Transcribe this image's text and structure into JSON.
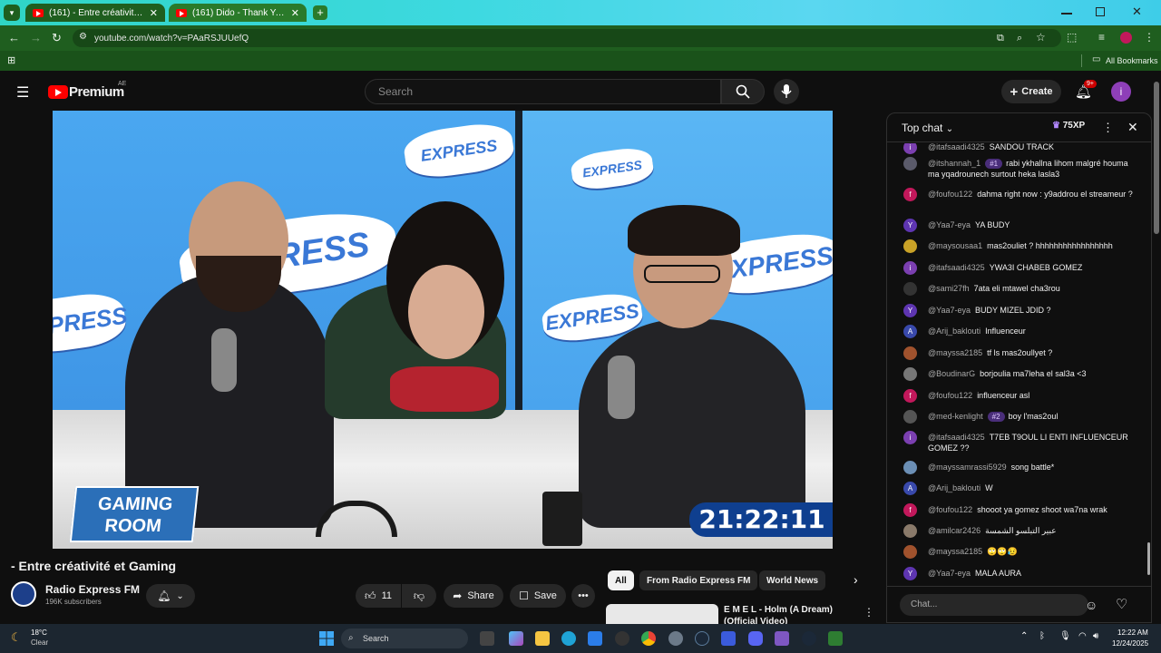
{
  "browser": {
    "tabs": [
      {
        "label": "(161) - Entre créativité et G",
        "active": true
      },
      {
        "label": "(161) Dido - Thank You (Officia",
        "active": false
      }
    ],
    "url": "youtube.com/watch?v=PAaRSJUUefQ",
    "bookmarks_label": "All Bookmarks"
  },
  "youtube": {
    "logo_text": "Premium",
    "region": "AE",
    "search_placeholder": "Search",
    "create_label": "Create",
    "notif_count": "9+",
    "avatar_letter": "i"
  },
  "video": {
    "brand_text": "EXPRESS",
    "timer": "21:22:11",
    "gaming_room_line1": "GAMING",
    "gaming_room_line2": "ROOM",
    "title": "- Entre créativité et Gaming",
    "channel_name": "Radio Express FM",
    "subscribers": "196K subscribers",
    "like_count": "11",
    "share_label": "Share",
    "save_label": "Save"
  },
  "recommendations": {
    "chips": [
      "All",
      "From Radio Express FM",
      "World News"
    ],
    "first_title_line1": "E M E L - Holm (A Dream)",
    "first_title_line2": "(Official Video)"
  },
  "chat": {
    "title": "Top chat",
    "xp": "75XP",
    "input_placeholder": "Chat...",
    "messages": [
      {
        "author": "@itafsaadi4325",
        "text": "SANDOU TRACK",
        "badge": "",
        "avatar": "i",
        "color": "#7b3fb0"
      },
      {
        "author": "@itshannah_1",
        "text": "rabi ykhallna lihom malgré houma ma yqadrounech surtout heka lasla3",
        "badge": "#1",
        "avatar": "",
        "color": "#5a5a6a"
      },
      {
        "author": "@foufou122",
        "text": "dahma right now : y9addrou el streameur ?",
        "badge": "",
        "avatar": "f",
        "color": "#c2185b"
      },
      {
        "author": "@Yaa7-eya",
        "text": "YA BUDY",
        "badge": "",
        "avatar": "Y",
        "color": "#5e35b1"
      },
      {
        "author": "@maysousaa1",
        "text": "mas2ouliet ? hhhhhhhhhhhhhhhhh",
        "badge": "",
        "avatar": "",
        "color": "#c9a227"
      },
      {
        "author": "@itafsaadi4325",
        "text": "YWA3I CHABEB GOMEZ",
        "badge": "",
        "avatar": "i",
        "color": "#7b3fb0"
      },
      {
        "author": "@sami27fh",
        "text": "7ata eli mtawel cha3rou",
        "badge": "",
        "avatar": "",
        "color": "#333333"
      },
      {
        "author": "@Yaa7-eya",
        "text": "BUDY MIZEL JDID ?",
        "badge": "",
        "avatar": "Y",
        "color": "#5e35b1"
      },
      {
        "author": "@Arij_baklouti",
        "text": "Influenceur",
        "badge": "",
        "avatar": "A",
        "color": "#3949ab"
      },
      {
        "author": "@mayssa2185",
        "text": "tf ls mas2oullyet ?",
        "badge": "",
        "avatar": "",
        "color": "#a0522d"
      },
      {
        "author": "@BoudinarG",
        "text": "borjoulia ma7leha el sal3a <3",
        "badge": "",
        "avatar": "",
        "color": "#777777"
      },
      {
        "author": "@foufou122",
        "text": "influenceur asl",
        "badge": "",
        "avatar": "f",
        "color": "#c2185b"
      },
      {
        "author": "@med-kenlight",
        "text": "boy l'mas2oul",
        "badge": "#2",
        "avatar": "",
        "color": "#555555"
      },
      {
        "author": "@itafsaadi4325",
        "text": "T7EB T9OUL LI ENTI INFLUENCEUR GOMEZ ??",
        "badge": "",
        "avatar": "i",
        "color": "#7b3fb0"
      },
      {
        "author": "@mayssamrassi5929",
        "text": "song battle*",
        "badge": "",
        "avatar": "",
        "color": "#6b8fb5"
      },
      {
        "author": "@Arij_baklouti",
        "text": "W",
        "badge": "",
        "avatar": "A",
        "color": "#3949ab"
      },
      {
        "author": "@foufou122",
        "text": "shooot ya gomez shoot wa7na wrak",
        "badge": "",
        "avatar": "f",
        "color": "#c2185b"
      },
      {
        "author": "@amilcar2426",
        "text": "عبير التبلسو الشمسة",
        "badge": "",
        "avatar": "",
        "color": "#8a7a6a"
      },
      {
        "author": "@mayssa2185",
        "text": "🙄🙄😥",
        "badge": "",
        "avatar": "",
        "color": "#a0522d"
      },
      {
        "author": "@Yaa7-eya",
        "text": "MALA AURA",
        "badge": "",
        "avatar": "Y",
        "color": "#5e35b1"
      }
    ]
  },
  "taskbar": {
    "weather_temp": "18°C",
    "weather_desc": "Clear",
    "search_label": "Search",
    "time": "12:22 AM",
    "date": "12/24/2025"
  },
  "colors": {
    "tabstrip": "#3dd9e0",
    "toolbar": "#1f5e1f",
    "youtube_red": "#ff0000",
    "chat_badge": "#4a2e7a"
  }
}
